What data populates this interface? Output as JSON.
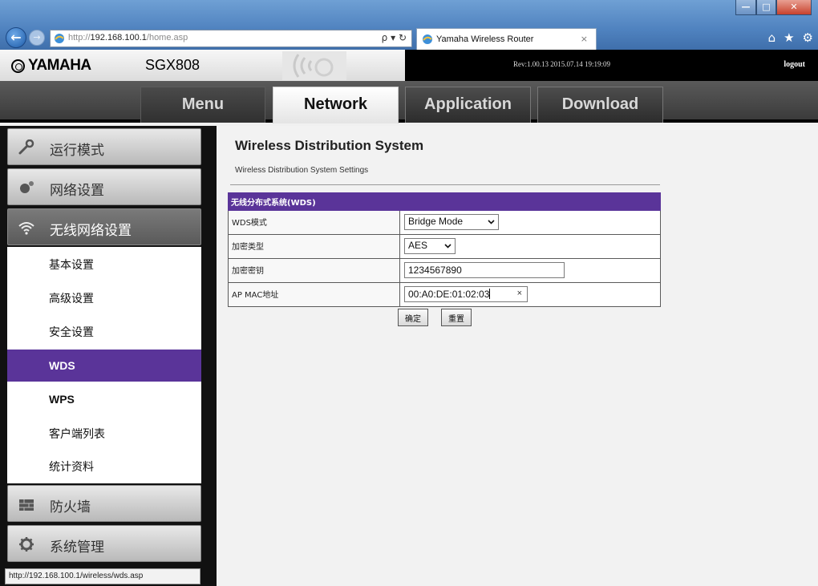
{
  "browser": {
    "url_prefix": "http://",
    "url_host": "192.168.100.1",
    "url_path": "/home.asp",
    "address_tools": "ρ ▾ ↻",
    "tab_title": "Yamaha Wireless Router",
    "tab_close": "×",
    "back": "←",
    "forward": "→",
    "win_min": "—",
    "win_max": "□",
    "win_close": "✕",
    "home": "⌂",
    "favorites": "★",
    "settings": "⚙"
  },
  "header": {
    "brand": "YAMAHA",
    "model": "SGX808",
    "revision": "Rev:1.00.13   2015.07.14 19:19:09",
    "logout": "logout"
  },
  "menu": {
    "items": [
      {
        "label": "Menu"
      },
      {
        "label": "Network"
      },
      {
        "label": "Application"
      },
      {
        "label": "Download"
      }
    ],
    "active": "Network"
  },
  "sidebar": {
    "main_items": [
      {
        "label": "运行模式",
        "icon": "wrench-icon"
      },
      {
        "label": "网络设置",
        "icon": "network-icon"
      },
      {
        "label": "无线网络设置",
        "icon": "wifi-icon"
      },
      {
        "label": "防火墙",
        "icon": "firewall-icon"
      },
      {
        "label": "系统管理",
        "icon": "gear-icon"
      }
    ],
    "sub_items": [
      {
        "label": "基本设置"
      },
      {
        "label": "高级设置"
      },
      {
        "label": "安全设置"
      },
      {
        "label": "WDS"
      },
      {
        "label": "WPS"
      },
      {
        "label": "客户端列表"
      },
      {
        "label": "统计资料"
      }
    ],
    "active_sub": "WDS"
  },
  "status_bar": "http://192.168.100.1/wireless/wds.asp",
  "content": {
    "title": "Wireless Distribution System",
    "subtitle": "Wireless Distribution System Settings",
    "form_header": "无线分布式系统(WDS)",
    "rows": [
      {
        "label": "WDS模式",
        "value": "Bridge Mode"
      },
      {
        "label": "加密类型",
        "value": "AES"
      },
      {
        "label": "加密密钥",
        "value": "1234567890"
      },
      {
        "label": "AP MAC地址",
        "value": "00:A0:DE:01:02:03"
      }
    ],
    "mac_clear": "×",
    "apply_label": "确定",
    "reset_label": "重置"
  },
  "colors": {
    "accent": "#5a3499"
  }
}
